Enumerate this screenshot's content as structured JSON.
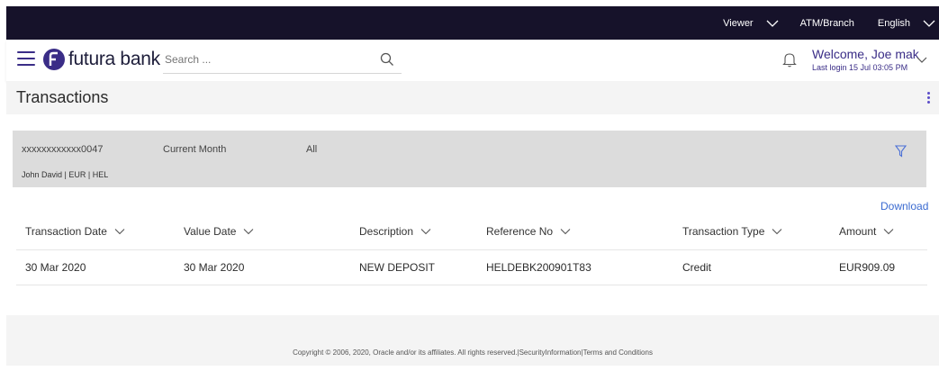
{
  "topbar": {
    "role_label": "Viewer",
    "atm_label": "ATM/Branch",
    "language_label": "English"
  },
  "header": {
    "brand": "futura bank",
    "search_placeholder": "Search ...",
    "welcome": "Welcome, Joe mak",
    "last_login": "Last login 15 Jul 03:05 PM"
  },
  "page": {
    "title": "Transactions"
  },
  "filter": {
    "account": "xxxxxxxxxxxx0047",
    "account_detail": "John David | EUR | HEL",
    "period": "Current Month",
    "type": "All"
  },
  "download_label": "Download",
  "table": {
    "columns": [
      "Transaction Date",
      "Value Date",
      "Description",
      "Reference No",
      "Transaction Type",
      "Amount"
    ],
    "rows": [
      [
        "30 Mar 2020",
        "30 Mar 2020",
        "NEW DEPOSIT",
        "HELDEBK200901T83",
        "Credit",
        "EUR909.09"
      ]
    ]
  },
  "footer": {
    "text": "Copyright © 2006, 2020, Oracle and/or its affiliates. All rights reserved.|SecurityInformation|Terms and Conditions"
  },
  "colors": {
    "topbar_bg": "#16122a",
    "brand_purple": "#3a2d87",
    "link_blue": "#3a6ad0",
    "filter_bar_bg": "#dcdcdc"
  }
}
